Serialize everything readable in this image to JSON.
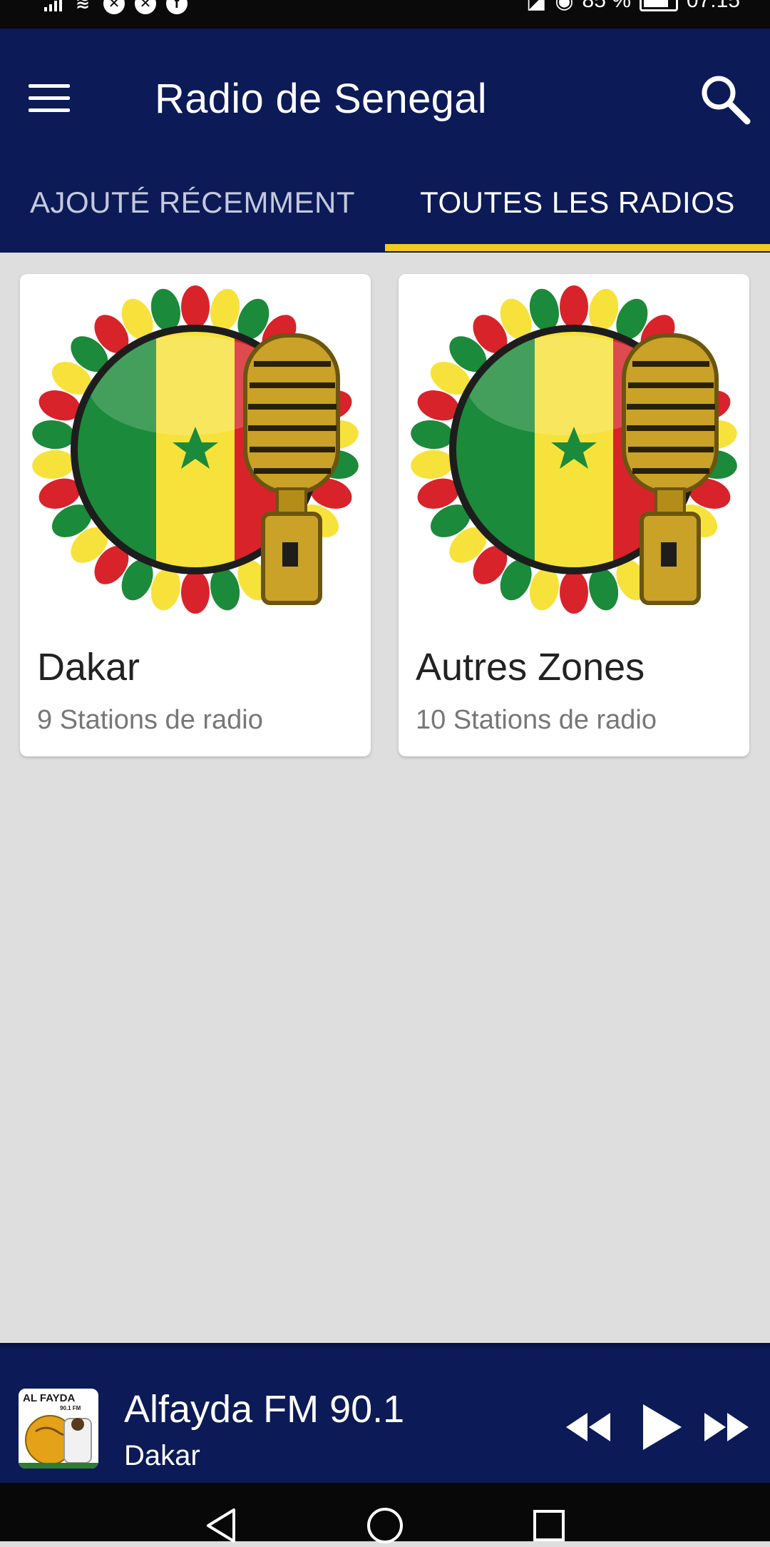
{
  "status_bar": {
    "battery": "85 %",
    "time": "07:15"
  },
  "app": {
    "title": "Radio de Senegal"
  },
  "tabs": [
    {
      "label": "AJOUTÉ RÉCEMMENT",
      "selected": false
    },
    {
      "label": "TOUTES LES RADIOS",
      "selected": true
    }
  ],
  "cards": [
    {
      "title": "Dakar",
      "subtitle": "9 Stations de radio",
      "icon": "senegal-flag-microphone-icon"
    },
    {
      "title": "Autres Zones",
      "subtitle": "10 Stations de radio",
      "icon": "senegal-flag-microphone-icon"
    }
  ],
  "player": {
    "station": "Alfayda FM 90.1",
    "city": "Dakar",
    "thumb_brand": "AL FAYDA",
    "thumb_freq": "90.1 FM"
  },
  "colors": {
    "app_bar": "#0c1a57",
    "tab_indicator": "#f2cb1d",
    "background": "#dedede",
    "flag_green": "#1b8a3a",
    "flag_yellow": "#f7e23b",
    "flag_red": "#d8232a"
  }
}
